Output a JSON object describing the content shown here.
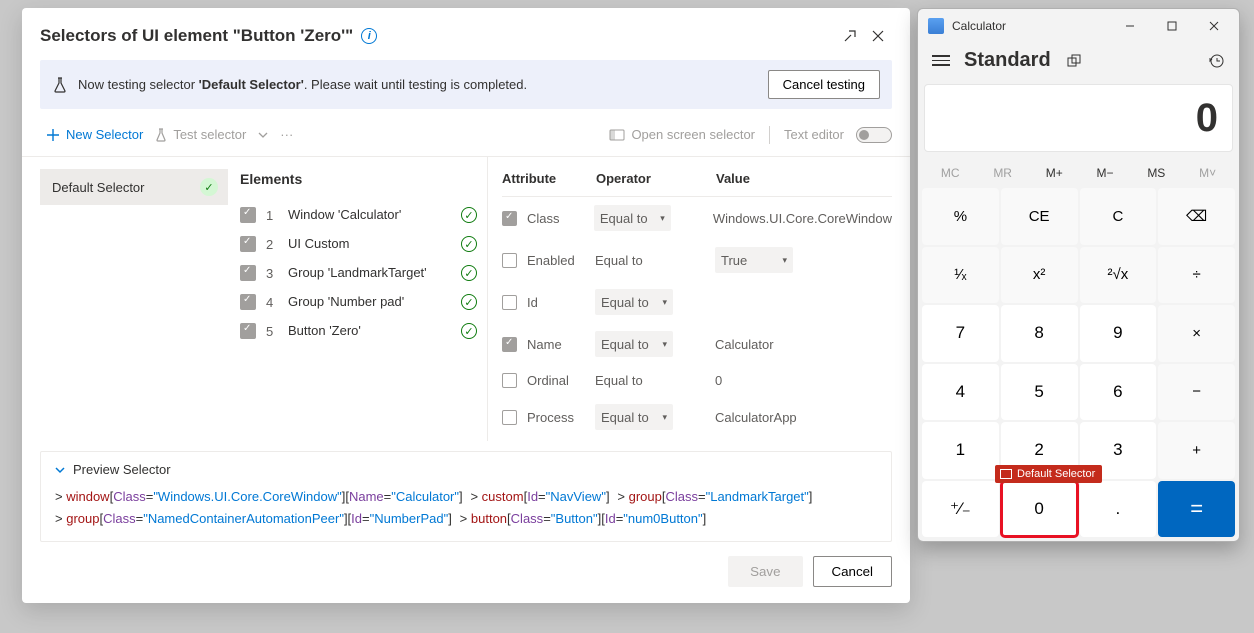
{
  "dialog": {
    "title": "Selectors of UI element \"Button 'Zero'\"",
    "testing_msg_prefix": "Now testing selector ",
    "testing_selector": "'Default Selector'",
    "testing_msg_suffix": ". Please wait until testing is completed.",
    "cancel_testing": "Cancel testing",
    "new_selector": "New Selector",
    "test_selector": "Test selector",
    "open_screen_selector": "Open screen selector",
    "text_editor": "Text editor",
    "default_selector": "Default Selector",
    "elements_header": "Elements",
    "elements": [
      {
        "n": "1",
        "label": "Window 'Calculator'"
      },
      {
        "n": "2",
        "label": "UI Custom"
      },
      {
        "n": "3",
        "label": "Group 'LandmarkTarget'"
      },
      {
        "n": "4",
        "label": "Group 'Number pad'"
      },
      {
        "n": "5",
        "label": "Button 'Zero'"
      }
    ],
    "attr_head": {
      "a": "Attribute",
      "o": "Operator",
      "v": "Value"
    },
    "attrs": [
      {
        "on": true,
        "name": "Class",
        "op": "Equal to",
        "boxed": true,
        "value": "Windows.UI.Core.CoreWindow"
      },
      {
        "on": false,
        "name": "Enabled",
        "op": "Equal to",
        "boxed": false,
        "value": "True",
        "valboxed": true
      },
      {
        "on": false,
        "name": "Id",
        "op": "Equal to",
        "boxed": true,
        "value": ""
      },
      {
        "on": true,
        "name": "Name",
        "op": "Equal to",
        "boxed": true,
        "value": "Calculator"
      },
      {
        "on": false,
        "name": "Ordinal",
        "op": "Equal to",
        "boxed": false,
        "value": "0"
      },
      {
        "on": false,
        "name": "Process",
        "op": "Equal to",
        "boxed": true,
        "value": "CalculatorApp"
      }
    ],
    "preview_label": "Preview Selector",
    "save": "Save",
    "cancel": "Cancel"
  },
  "calc": {
    "title": "Calculator",
    "mode": "Standard",
    "display": "0",
    "mem": [
      "MC",
      "MR",
      "M+",
      "M−",
      "MS",
      "M˅"
    ],
    "buttons": [
      [
        "%",
        "CE",
        "C",
        "⌫"
      ],
      [
        "¹⁄ₓ",
        "x²",
        "²√x",
        "÷"
      ],
      [
        "7",
        "8",
        "9",
        "×"
      ],
      [
        "4",
        "5",
        "6",
        "−"
      ],
      [
        "1",
        "2",
        "3",
        "+"
      ],
      [
        "⁺⁄₋",
        "0",
        ".",
        "="
      ]
    ],
    "tag": "Default Selector"
  }
}
